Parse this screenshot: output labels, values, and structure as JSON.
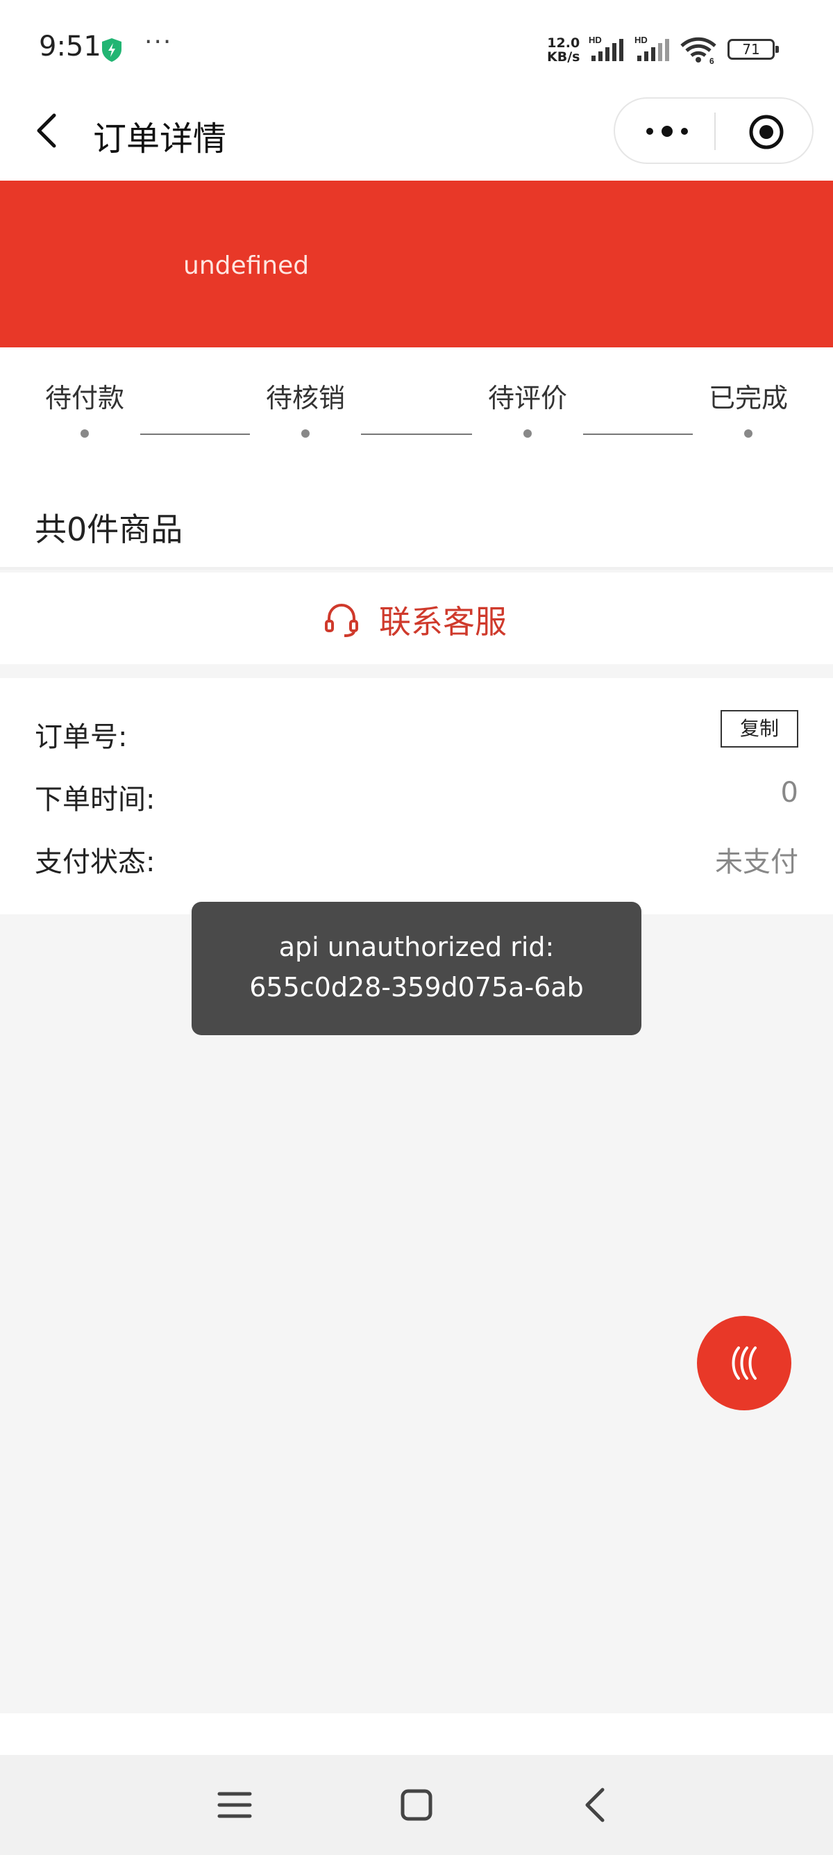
{
  "status_bar": {
    "time": "9:51",
    "more": "···",
    "speed_value": "12.0",
    "speed_unit": "KB/s",
    "signal_tag": "HD",
    "wifi_tag": "6",
    "battery": "71"
  },
  "nav": {
    "title": "订单详情"
  },
  "banner": {
    "text": "undefined"
  },
  "steps": [
    {
      "label": "待付款"
    },
    {
      "label": "待核销"
    },
    {
      "label": "待评价"
    },
    {
      "label": "已完成"
    }
  ],
  "goods": {
    "count_text": "共0件商品"
  },
  "contact": {
    "label": "联系客服"
  },
  "order_info": {
    "order_no_label": "订单号:",
    "copy_label": "复制",
    "time_label": "下单时间:",
    "time_value": "0",
    "pay_status_label": "支付状态:",
    "pay_status_value": "未支付"
  },
  "toast": {
    "line1": "api unauthorized rid:",
    "line2": "655c0d28-359d075a-6ab"
  },
  "colors": {
    "accent_red": "#e83828",
    "contact_red": "#cf3a2c",
    "toast_bg": "#4a4a4a"
  }
}
